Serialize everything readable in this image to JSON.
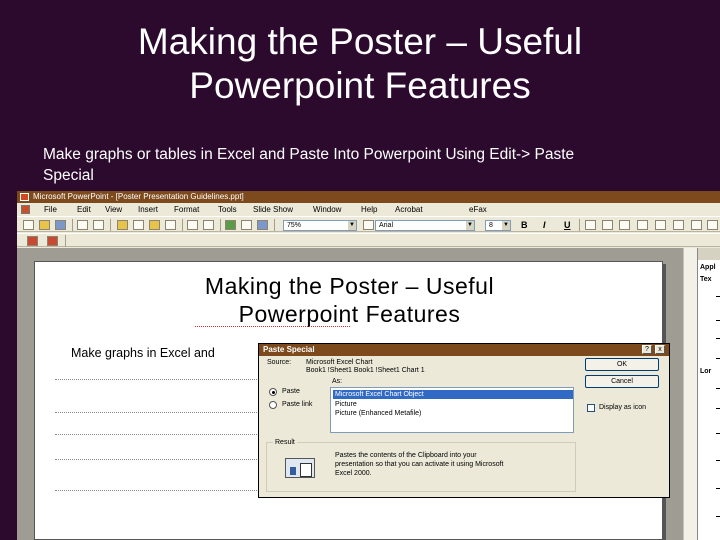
{
  "slide": {
    "title_line1": "Making the Poster – Useful",
    "title_line2": "Powerpoint Features",
    "body_line1": "Make graphs or tables in Excel and Paste Into Powerpoint Using Edit-> Paste",
    "body_line2": "Special"
  },
  "window": {
    "title": "Microsoft PowerPoint - [Poster Presentation Guidelines.ppt]"
  },
  "menu": {
    "items": [
      "File",
      "Edit",
      "View",
      "Insert",
      "Format",
      "Tools",
      "Slide Show",
      "Window",
      "Help",
      "Acrobat",
      "eFax"
    ]
  },
  "toolbar": {
    "zoom_value": "75%",
    "font_value": "Arial",
    "size_value": "8",
    "bold_label": "B",
    "italic_label": "I",
    "underline_label": "U"
  },
  "inner_slide": {
    "title_line1": "Making the Poster – Useful",
    "title_line2": "Powerpoint Features",
    "body": "Make graphs in Excel and"
  },
  "dialog": {
    "title": "Paste Special",
    "help_label": "?",
    "close_label": "x",
    "source_label": "Source:",
    "source_value": "Microsoft Excel Chart",
    "source_path": "Book1 !Sheet1 Book1 !Sheet1 Chart 1",
    "as_label": "As:",
    "paste_label": "Paste",
    "paste_link_label": "Paste link",
    "list_items": [
      "Microsoft Excel Chart Object",
      "Picture",
      "Picture (Enhanced Metafile)"
    ],
    "ok_label": "OK",
    "cancel_label": "Cancel",
    "display_icon_label": "Display as icon",
    "result_label": "Result",
    "result_line1": "Pastes the contents of the Clipboard into your",
    "result_line2": "presentation so that you can activate it using Microsoft",
    "result_line3": "Excel 2000."
  },
  "taskpane": {
    "label1": "Appl",
    "label2": "Tex",
    "label3": "Lor"
  },
  "colors": {
    "background": "#2b0a2e",
    "titlebar": "#7d4a1d",
    "dialog_selection": "#316ac5"
  }
}
